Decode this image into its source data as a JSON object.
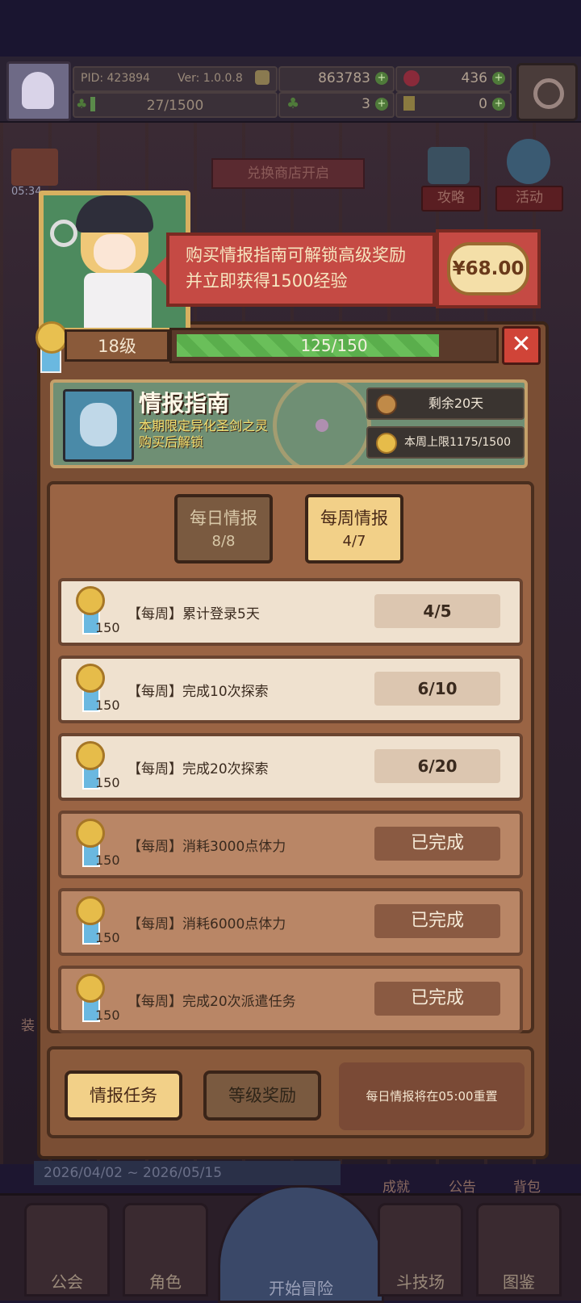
{
  "header": {
    "pid": "PID: 423894",
    "version": "Ver: 1.0.0.8",
    "coins": "863783",
    "gems": "436",
    "xp": "27/1500",
    "clover_count": "3",
    "key_count": "0"
  },
  "background": {
    "timestamp": "05:34",
    "shop_banner": "兑换商店开启",
    "guide_btn": "攻略",
    "activity_btn": "活动",
    "date_range": "2026/04/02 ~ 2026/05/15",
    "achievement": "成就",
    "notice": "公告",
    "bag": "背包",
    "equip_partial": "装"
  },
  "bottom_nav": {
    "guild": "公会",
    "role": "角色",
    "start": "开始冒险",
    "arena": "斗技场",
    "codex": "图鉴"
  },
  "popup": {
    "promo_line1": "购买情报指南可解锁高级奖励",
    "promo_line2": "并立即获得1500经验",
    "price": "¥68.00",
    "level": "18级",
    "level_progress": "125/150",
    "level_fraction": 0.833,
    "close": "✕",
    "guide_title": "情报指南",
    "guide_sub1": "本期限定异化圣剑之灵",
    "guide_sub2": "购买后解锁",
    "remaining": "剩余20天",
    "weekly_cap": "本周上限1175/1500",
    "tabs": [
      {
        "label": "每日情报",
        "count": "8/8"
      },
      {
        "label": "每周情报",
        "count": "4/7"
      }
    ],
    "tasks": [
      {
        "points": "150",
        "desc": "【每周】累计登录5天",
        "progress": "4/5",
        "state": "open"
      },
      {
        "points": "150",
        "desc": "【每周】完成10次探索",
        "progress": "6/10",
        "state": "open"
      },
      {
        "points": "150",
        "desc": "【每周】完成20次探索",
        "progress": "6/20",
        "state": "open"
      },
      {
        "points": "150",
        "desc": "【每周】消耗3000点体力",
        "progress": "已完成",
        "state": "done"
      },
      {
        "points": "150",
        "desc": "【每周】消耗6000点体力",
        "progress": "已完成",
        "state": "done"
      },
      {
        "points": "150",
        "desc": "【每周】完成20次派遣任务",
        "progress": "已完成",
        "state": "done"
      }
    ],
    "btn_tasks": "情报任务",
    "btn_rewards": "等级奖励",
    "reset_note": "每日情报将在05:00重置"
  }
}
